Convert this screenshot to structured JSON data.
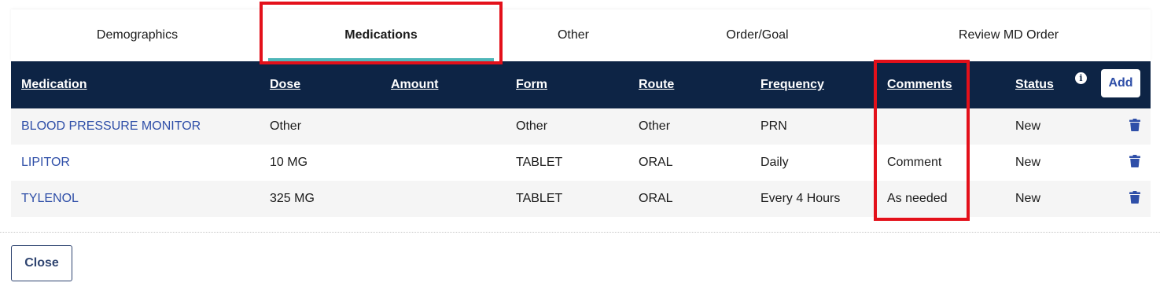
{
  "tabs": [
    {
      "label": "Demographics",
      "active": false
    },
    {
      "label": "Medications",
      "active": true
    },
    {
      "label": "Other",
      "active": false
    },
    {
      "label": "Order/Goal",
      "active": false
    },
    {
      "label": "Review MD Order",
      "active": false
    }
  ],
  "table": {
    "columns": [
      "Medication",
      "Dose",
      "Amount",
      "Form",
      "Route",
      "Frequency",
      "Comments",
      "Status"
    ],
    "add_label": "Add",
    "info_icon": "info-icon",
    "rows": [
      {
        "medication": "BLOOD PRESSURE MONITOR",
        "dose": "Other",
        "amount": "",
        "form": "Other",
        "route": "Other",
        "frequency": "PRN",
        "comments": "",
        "status": "New"
      },
      {
        "medication": "LIPITOR",
        "dose": "10 MG",
        "amount": "",
        "form": "TABLET",
        "route": "ORAL",
        "frequency": "Daily",
        "comments": "Comment",
        "status": "New"
      },
      {
        "medication": "TYLENOL",
        "dose": "325 MG",
        "amount": "",
        "form": "TABLET",
        "route": "ORAL",
        "frequency": "Every 4 Hours",
        "comments": "As needed",
        "status": "New"
      }
    ],
    "row_action_icon": "trash-icon"
  },
  "footer": {
    "close_label": "Close"
  },
  "colors": {
    "header_bg": "#0d2445",
    "link": "#2f4fa8",
    "tab_indicator": "#4fb6b8",
    "highlight": "#e3101a"
  }
}
